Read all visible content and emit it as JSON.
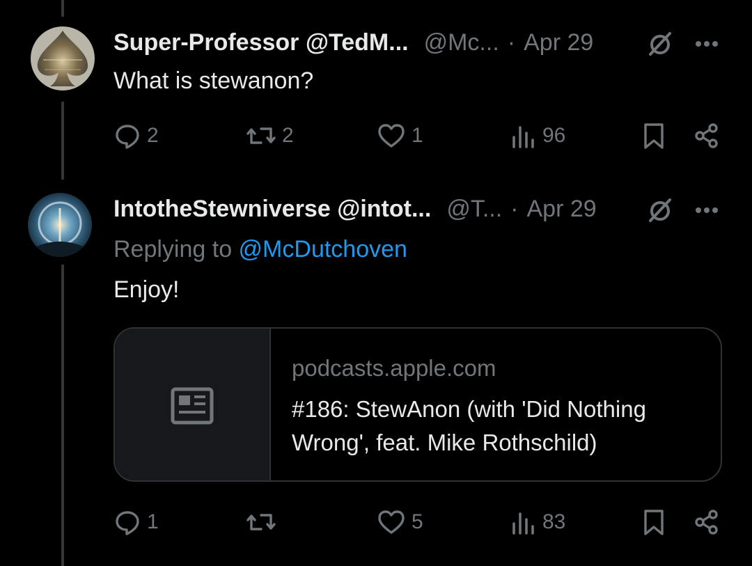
{
  "post1": {
    "display_name": "Super-Professor @TedM...",
    "handle": "@Mc...",
    "separator": "·",
    "date": "Apr 29",
    "text": "What is stewanon?",
    "replies": "2",
    "reposts": "2",
    "likes": "1",
    "views": "96"
  },
  "post2": {
    "display_name": "IntotheStewniverse @intot...",
    "handle": "@T...",
    "separator": "·",
    "date": "Apr 29",
    "replying_prefix": "Replying to ",
    "replying_to": "@McDutchoven",
    "text": "Enjoy!",
    "card": {
      "domain": "podcasts.apple.com",
      "title": "#186: StewAnon (with 'Did Nothing Wrong', feat. Mike Rothschild)"
    },
    "replies": "1",
    "reposts": "",
    "likes": "5",
    "views": "83"
  },
  "colors": {
    "background": "#000000",
    "text_primary": "#e7e9ea",
    "text_secondary": "#71767b",
    "accent": "#1d9bf0",
    "border": "#2f3336"
  },
  "icons": [
    "reply-icon",
    "repost-icon",
    "like-icon",
    "views-icon",
    "bookmark-icon",
    "share-icon",
    "grok-icon",
    "more-icon",
    "article-icon"
  ]
}
